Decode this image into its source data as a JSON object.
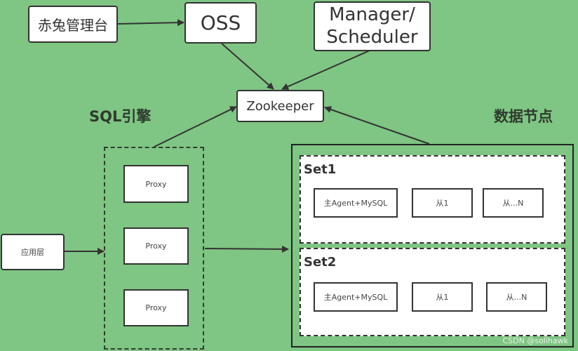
{
  "nodes": {
    "console": "赤兔管理台",
    "oss": "OSS",
    "manager": "Manager/\nScheduler",
    "zookeeper": "Zookeeper",
    "app_layer": "应用层",
    "proxies": [
      "Proxy",
      "Proxy",
      "Proxy"
    ]
  },
  "labels": {
    "sql_engine": "SQL引擎",
    "data_nodes": "数据节点"
  },
  "sets": [
    {
      "title": "Set1",
      "nodes": [
        "主Agent+MySQL",
        "从1",
        "从...N"
      ]
    },
    {
      "title": "Set2",
      "nodes": [
        "主Agent+MySQL",
        "从1",
        "从...N"
      ]
    }
  ],
  "watermark": "CSDN @solihawk",
  "colors": {
    "background": "#7fc583",
    "stroke": "#333333"
  }
}
